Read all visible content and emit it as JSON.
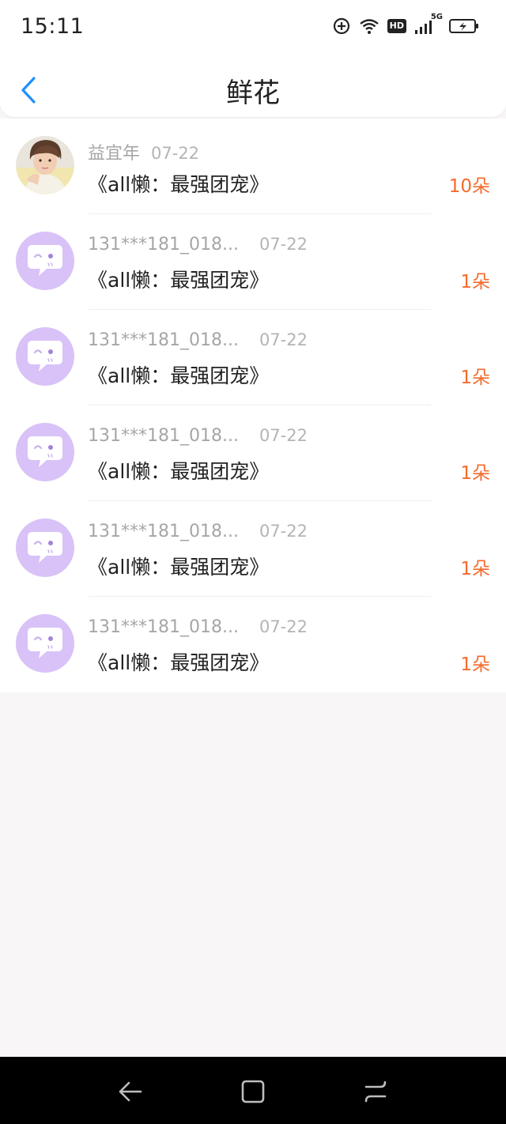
{
  "status_bar": {
    "time": "15:11",
    "hd_label": "HD",
    "network_label": "5G",
    "icons": [
      "location-icon",
      "wifi-icon",
      "hd-icon",
      "signal-icon",
      "battery-charging-icon"
    ]
  },
  "header": {
    "title": "鲜花",
    "back_icon": "chevron-left-icon"
  },
  "records": [
    {
      "user": "益宜年",
      "date": "07-22",
      "book": "《all懒：最强团宠》",
      "count": "10朵",
      "avatar": "photo"
    },
    {
      "user": "131***181_018...",
      "date": "07-22",
      "book": "《all懒：最强团宠》",
      "count": "1朵",
      "avatar": "default"
    },
    {
      "user": "131***181_018...",
      "date": "07-22",
      "book": "《all懒：最强团宠》",
      "count": "1朵",
      "avatar": "default"
    },
    {
      "user": "131***181_018...",
      "date": "07-22",
      "book": "《all懒：最强团宠》",
      "count": "1朵",
      "avatar": "default"
    },
    {
      "user": "131***181_018...",
      "date": "07-22",
      "book": "《all懒：最强团宠》",
      "count": "1朵",
      "avatar": "default"
    },
    {
      "user": "131***181_018...",
      "date": "07-22",
      "book": "《all懒：最强团宠》",
      "count": "1朵",
      "avatar": "default"
    }
  ],
  "colors": {
    "accent_blue": "#1e90ff",
    "count_orange": "#f36b2b",
    "default_avatar": "#d8c2f7",
    "page_bg": "#f8f6f7"
  },
  "nav_bar": {
    "buttons": [
      "back-nav-icon",
      "home-nav-icon",
      "recents-nav-icon"
    ]
  }
}
